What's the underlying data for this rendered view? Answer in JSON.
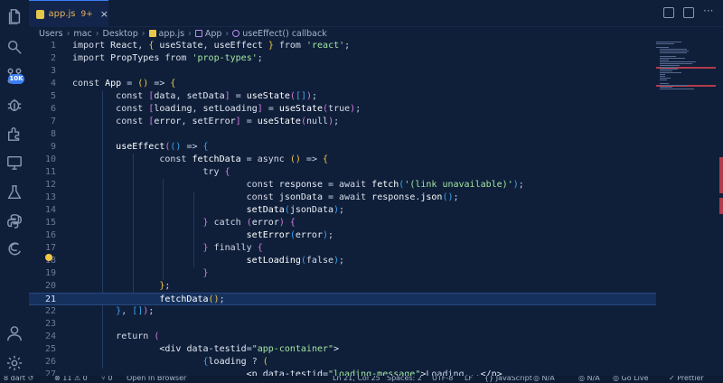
{
  "tab": {
    "name": "app.js",
    "problems": "9+",
    "close": "×"
  },
  "breadcrumb": [
    "Users",
    "mac",
    "Desktop",
    "app.js",
    "App",
    "useEffect() callback"
  ],
  "activity_badge": "10K",
  "icons": [
    "files-icon",
    "search-icon",
    "source-control-icon",
    "debug-icon",
    "extensions-icon",
    "remote-explorer-icon",
    "testing-icon",
    "python-icon",
    "edge-icon",
    "account-icon",
    "settings-gear-icon"
  ],
  "status": [
    "8 dart ↺",
    "⊗ 11 ⚠ 0",
    "⑂ 0",
    "Open In Browser",
    "Ln 21, Col 25",
    "Spaces: 2",
    "UTF-8",
    "LF",
    "{} JavaScript",
    "◎ N/A",
    "◎ N/A",
    "◎ Go Live",
    "✓ Prettier"
  ],
  "current_line": 21,
  "code_lines": [
    {
      "n": "1",
      "html": "<span class='kw'>import</span> <span class='pl'>React</span>, <span class='brk'>{</span> <span class='pl'>useState</span>, <span class='pl'>useEffect</span> <span class='brk'>}</span> <span class='kw'>from</span> <span class='str'>'react'</span>;"
    },
    {
      "n": "2",
      "html": "<span class='kw'>import</span> <span class='pl'>PropTypes</span> <span class='kw'>from</span> <span class='str'>'prop-types'</span>;"
    },
    {
      "n": "3",
      "html": ""
    },
    {
      "n": "4",
      "html": "<span class='kw'>const</span> <span class='fnc'>App</span> = <span class='brk'>()</span> =&gt; <span class='brk'>{</span>"
    },
    {
      "n": "5",
      "html": "        <span class='kw'>const</span> <span class='brk2'>[</span><span class='pl'>data</span>, <span class='pl'>setData</span><span class='brk2'>]</span> = <span class='fnc'>useState</span><span class='brk2'>(</span><span class='brk3'>[]</span><span class='brk2'>)</span>;"
    },
    {
      "n": "6",
      "html": "        <span class='kw'>const</span> <span class='brk2'>[</span><span class='pl'>loading</span>, <span class='pl'>setLoading</span><span class='brk2'>]</span> = <span class='fnc'>useState</span><span class='brk2'>(</span><span class='kw'>true</span><span class='brk2'>)</span>;"
    },
    {
      "n": "7",
      "html": "        <span class='kw'>const</span> <span class='brk2'>[</span><span class='pl'>error</span>, <span class='pl'>setError</span><span class='brk2'>]</span> = <span class='fnc'>useState</span><span class='brk2'>(</span><span class='kw'>null</span><span class='brk2'>)</span>;"
    },
    {
      "n": "8",
      "html": ""
    },
    {
      "n": "9",
      "html": "        <span class='fnc'>useEffect</span><span class='brk2'>(</span><span class='brk3'>()</span> =&gt; <span class='brk3'>{</span>"
    },
    {
      "n": "10",
      "html": "                <span class='kw'>const</span> <span class='fnc'>fetchData</span> = <span class='kw'>async</span> <span class='brk'>()</span> =&gt; <span class='brk'>{</span>"
    },
    {
      "n": "11",
      "html": "                        <span class='kw'>try</span> <span class='brk2'>{</span>"
    },
    {
      "n": "12",
      "html": "                                <span class='kw'>const</span> <span class='pl'>response</span> = <span class='kw'>await</span> <span class='fnc'>fetch</span><span class='brk3'>(</span><span class='str'>'(link unavailable)'</span><span class='brk3'>)</span>;"
    },
    {
      "n": "13",
      "html": "                                <span class='kw'>const</span> <span class='pl'>jsonData</span> = <span class='kw'>await</span> <span class='pl'>response</span>.<span class='fnc'>json</span><span class='brk3'>()</span>;"
    },
    {
      "n": "14",
      "html": "                                <span class='fnc'>setData</span><span class='brk3'>(</span><span class='pl'>jsonData</span><span class='brk3'>)</span>;"
    },
    {
      "n": "15",
      "html": "                        <span class='brk2'>}</span> <span class='kw'>catch</span> <span class='brk2'>(</span><span class='pl'>error</span><span class='brk2'>)</span> <span class='brk2'>{</span>"
    },
    {
      "n": "16",
      "html": "                                <span class='fnc'>setError</span><span class='brk3'>(</span><span class='pl'>error</span><span class='brk3'>)</span>;"
    },
    {
      "n": "17",
      "html": "                        <span class='brk2'>}</span> <span class='kw'>finally</span> <span class='brk2'>{</span>"
    },
    {
      "n": "18",
      "html": "                                <span class='fnc'>setLoading</span><span class='brk3'>(</span><span class='kw'>false</span><span class='brk3'>)</span>;"
    },
    {
      "n": "19",
      "html": "                        <span class='brk2'>}</span>"
    },
    {
      "n": "20",
      "html": "                <span class='brk'>}</span>;"
    },
    {
      "n": "21",
      "html": "                <span class='fnc'>fetchData</span><span class='brk'>()</span>;"
    },
    {
      "n": "22",
      "html": "        <span class='brk3'>}</span>, <span class='brk3'>[]</span><span class='brk2'>)</span>;"
    },
    {
      "n": "23",
      "html": ""
    },
    {
      "n": "24",
      "html": "        <span class='kw'>return</span> <span class='brk2'>(</span>"
    },
    {
      "n": "25",
      "html": "                <span class='tag'>&lt;div</span> <span class='pl'>data-testid</span>=<span class='str'>\"app-container\"</span><span class='tag'>&gt;</span>"
    },
    {
      "n": "26",
      "html": "                        <span class='brk3'>{</span><span class='pl'>loading</span> ? <span class='brk'>(</span>"
    },
    {
      "n": "27",
      "html": "                                <span class='tag'>&lt;p</span> <span class='pl'>data-testid</span>=<span class='str'>\"loading-message\"</span><span class='tag'>&gt;</span>Loading...<span class='tag'>&lt;/p&gt;</span>"
    }
  ]
}
